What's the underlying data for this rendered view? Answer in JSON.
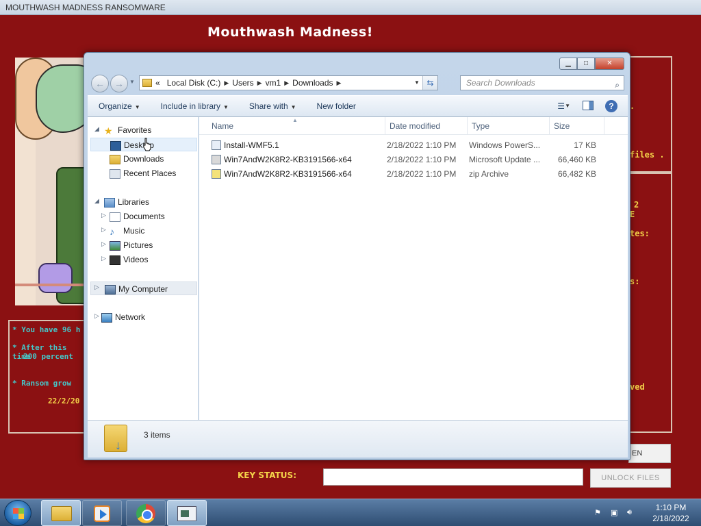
{
  "ransom": {
    "window_title": "MOUTHWASH MADNESS RANSOMWARE",
    "heading": "Mouthwash Madness!",
    "right_fragments": [
      ".",
      "files .",
      "2",
      "E",
      "tes:",
      "s:",
      "ved"
    ],
    "left_messages": {
      "line1": "* You have 96 h",
      "line2": "* After this time",
      "line3": "200 percent",
      "line4": "* Ransom grow",
      "line5": "22/2/20"
    },
    "key_status_label": "KEY STATUS:",
    "key_input_value": "",
    "unlock_button": "UNLOCK FILES",
    "partial_button": "EN"
  },
  "explorer": {
    "address": {
      "overflow": "«",
      "crumbs": [
        "Local Disk (C:)",
        "Users",
        "vm1",
        "Downloads"
      ]
    },
    "search_placeholder": "Search Downloads",
    "toolbar": {
      "organize": "Organize",
      "include": "Include in library",
      "share": "Share with",
      "new_folder": "New folder"
    },
    "nav": {
      "favorites": "Favorites",
      "desktop": "Desktop",
      "downloads": "Downloads",
      "recent": "Recent Places",
      "libraries": "Libraries",
      "documents": "Documents",
      "music": "Music",
      "pictures": "Pictures",
      "videos": "Videos",
      "computer": "My Computer",
      "network": "Network"
    },
    "columns": {
      "name": "Name",
      "date": "Date modified",
      "type": "Type",
      "size": "Size"
    },
    "files": [
      {
        "name": "Install-WMF5.1",
        "date": "2/18/2022 1:10 PM",
        "type": "Windows PowerS...",
        "size": "17 KB",
        "icon": "powershell-script-icon"
      },
      {
        "name": "Win7AndW2K8R2-KB3191566-x64",
        "date": "2/18/2022 1:10 PM",
        "type": "Microsoft Update ...",
        "size": "66,460 KB",
        "icon": "update-package-icon"
      },
      {
        "name": "Win7AndW2K8R2-KB3191566-x64",
        "date": "2/18/2022 1:10 PM",
        "type": "zip Archive",
        "size": "66,482 KB",
        "icon": "zip-archive-icon"
      }
    ],
    "status": "3 items"
  },
  "taskbar": {
    "clock_time": "1:10 PM",
    "clock_date": "2/18/2022"
  }
}
